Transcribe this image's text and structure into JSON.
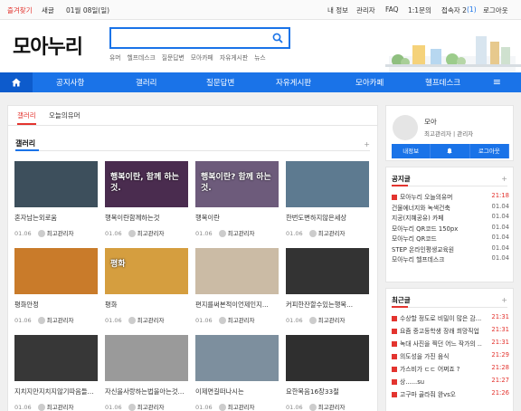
{
  "topbar": {
    "left": [
      "즐겨찾기",
      "새글",
      "01월 08일(일)"
    ],
    "right": [
      "내 정보",
      "관리자",
      "FAQ",
      "1:1문의",
      "접속자 2",
      "(1)",
      "로그아웃"
    ]
  },
  "header": {
    "logo": "모아누리",
    "search_placeholder": "",
    "tags": [
      "유머",
      "헬프데스크",
      "질문답변",
      "모아카페",
      "자유게시판",
      "뉴스"
    ]
  },
  "nav": {
    "items": [
      "공지사항",
      "갤러리",
      "질문답변",
      "자유게시판",
      "모아카페",
      "헬프데스크"
    ],
    "home_icon": "home-icon",
    "menu_icon": "hamburger-icon"
  },
  "main": {
    "tabs": [
      "갤러리",
      "오늘의유머"
    ],
    "section_title": "갤러리",
    "more": "+",
    "cards": [
      {
        "title": "혼자남는외로움",
        "date": "01.06",
        "author": "최고관리자",
        "bg": "#3d4f5c",
        "caption": ""
      },
      {
        "title": "행복이란함께하는것",
        "date": "01.06",
        "author": "최고관리자",
        "bg": "#4a2c4f",
        "caption": "행복이란, 함께 하는 것."
      },
      {
        "title": "행복이란",
        "date": "01.06",
        "author": "최고관리자",
        "bg": "#6d5b7b",
        "caption": "행복이란? 함께 하는 것."
      },
      {
        "title": "한번도변하지않은세상",
        "date": "01.06",
        "author": "최고관리자",
        "bg": "#5d7a90",
        "caption": ""
      },
      {
        "title": "평화안정",
        "date": "01.06",
        "author": "최고관리자",
        "bg": "#c97b2a",
        "caption": ""
      },
      {
        "title": "평화",
        "date": "01.06",
        "author": "최고관리자",
        "bg": "#d59e3f",
        "caption": "평화"
      },
      {
        "title": "편지를써본적이언제인지...",
        "date": "01.06",
        "author": "최고관리자",
        "bg": "#cbbba5",
        "caption": ""
      },
      {
        "title": "커피한잔할수있는행복...",
        "date": "01.06",
        "author": "최고관리자",
        "bg": "#333333",
        "caption": ""
      },
      {
        "title": "지치지만지치지않기따음들...",
        "date": "01.06",
        "author": "최고관리자",
        "bg": "#373737",
        "caption": ""
      },
      {
        "title": "자신을사랑하는법을아는것...",
        "date": "01.06",
        "author": "최고관리자",
        "bg": "#9a9a9a",
        "caption": ""
      },
      {
        "title": "이제면길떠나시는",
        "date": "01.06",
        "author": "최고관리자",
        "bg": "#7d8f9e",
        "caption": ""
      },
      {
        "title": "요한복음16장33절",
        "date": "01.06",
        "author": "최고관리자",
        "bg": "#2f2f2f",
        "caption": ""
      }
    ]
  },
  "profile": {
    "name": "모아",
    "role": "최고관리자 | 관리자",
    "buttons": [
      "내정보",
      "",
      "로그아웃"
    ],
    "bell_icon": "bell-icon"
  },
  "notice": {
    "title": "공지글",
    "more": "+",
    "items": [
      {
        "t": "모아누리 오늘의유머",
        "d": "21:18",
        "red": true,
        "new": true
      },
      {
        "t": "건물에너지와 녹색건축",
        "d": "01.04",
        "red": false,
        "new": false
      },
      {
        "t": "지공(지혜공유) 카페",
        "d": "01.04",
        "red": false,
        "new": false
      },
      {
        "t": "모아누리 QR코드 150px",
        "d": "01.04",
        "red": false,
        "new": false
      },
      {
        "t": "모아누리 QR코드",
        "d": "01.04",
        "red": false,
        "new": false
      },
      {
        "t": "STEP 온라인평생교육원",
        "d": "01.04",
        "red": false,
        "new": false
      },
      {
        "t": "모아누리 헬프데스크",
        "d": "01.04",
        "red": false,
        "new": false
      }
    ]
  },
  "recent": {
    "title": "최근글",
    "more": "+",
    "items": [
      {
        "t": "수상할 정도로 비밀이 많은 감...",
        "d": "21:31"
      },
      {
        "t": "요즘 중고등학생 장래 희망직업",
        "d": "21:31"
      },
      {
        "t": "녹대 사진을 찍던 어느 작가의 ...",
        "d": "21:31"
      },
      {
        "t": "의도성을 가진 음식",
        "d": "21:29"
      },
      {
        "t": "가스비가 ㄷㄷ 어쩌죠 ?",
        "d": "21:28"
      },
      {
        "t": "상......su",
        "d": "21:27"
      },
      {
        "t": "고구마 골라줘 완vs오",
        "d": "21:26"
      }
    ]
  }
}
